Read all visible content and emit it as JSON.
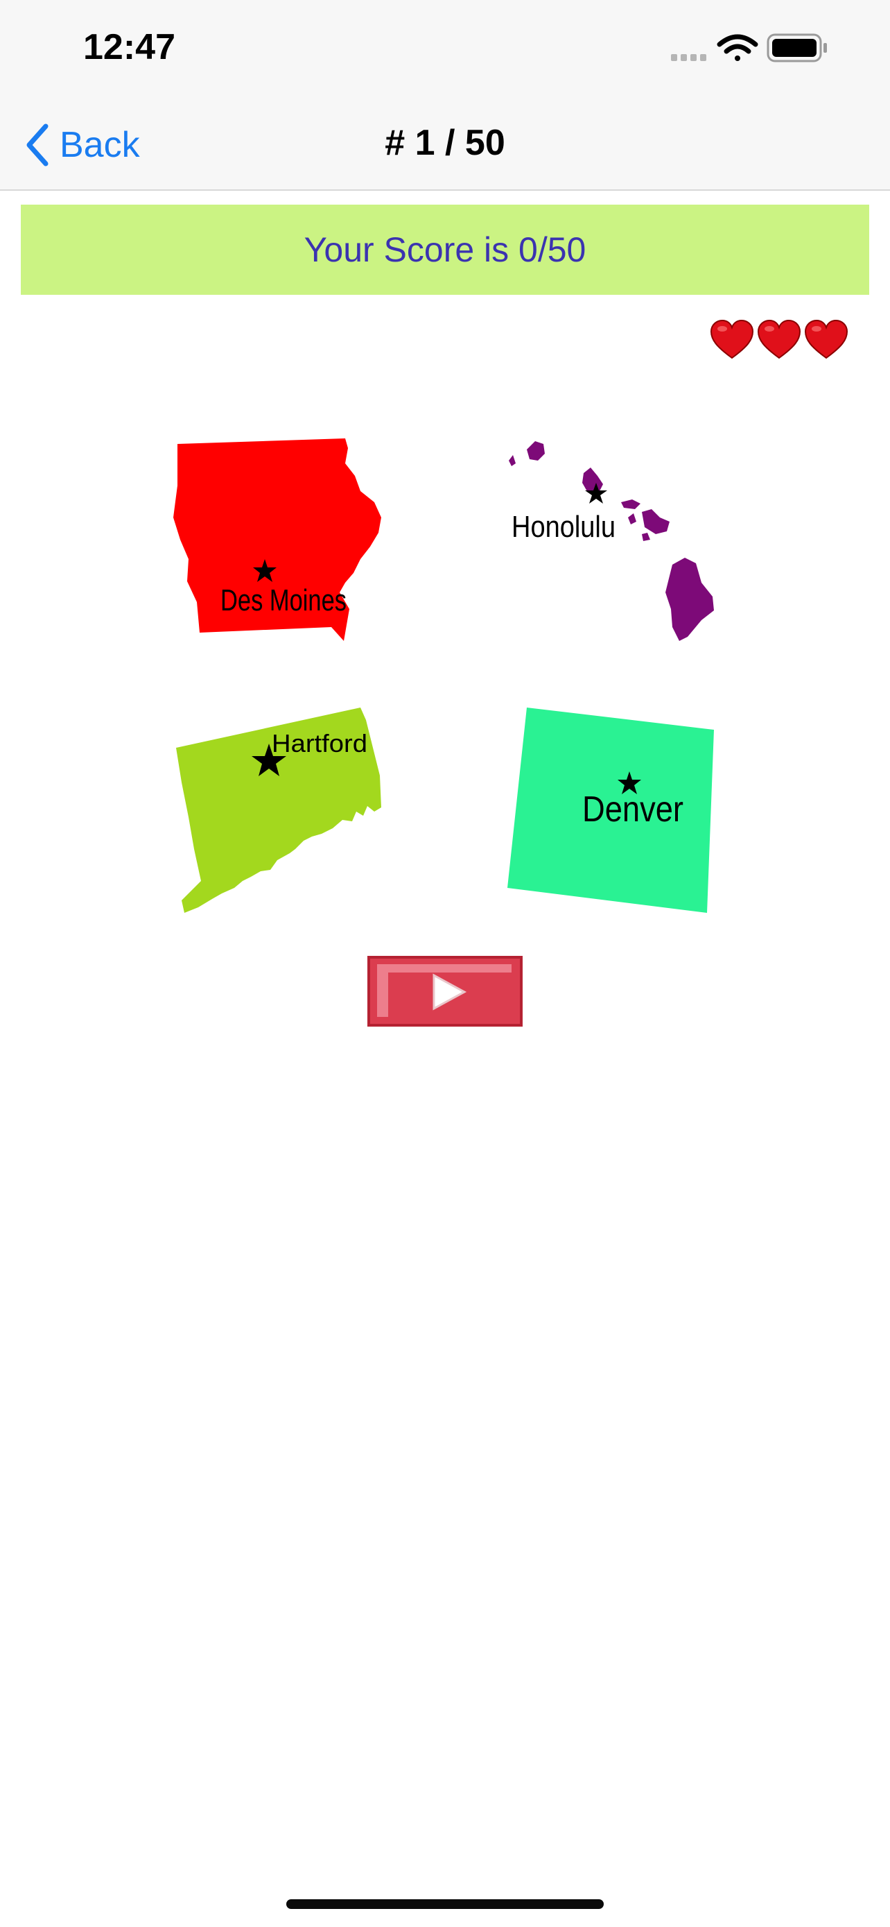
{
  "status_bar": {
    "time": "12:47",
    "icons": [
      "signal-icon",
      "wifi-icon",
      "battery-icon"
    ]
  },
  "nav": {
    "back_label": "Back",
    "title": "# 1 / 50"
  },
  "score": {
    "text": "Your Score is 0/50"
  },
  "lives": {
    "count": 3,
    "icon": "heart-icon",
    "color": "#e0101a"
  },
  "choices": [
    {
      "capital": "Des Moines",
      "color": "#ff0000"
    },
    {
      "capital": "Honolulu",
      "color": "#7d0a78"
    },
    {
      "capital": "Hartford",
      "color": "#a3d81e"
    },
    {
      "capital": "Denver",
      "color": "#2af293"
    }
  ],
  "play_button": {
    "icon": "play-icon",
    "color": "#db3d4f"
  }
}
